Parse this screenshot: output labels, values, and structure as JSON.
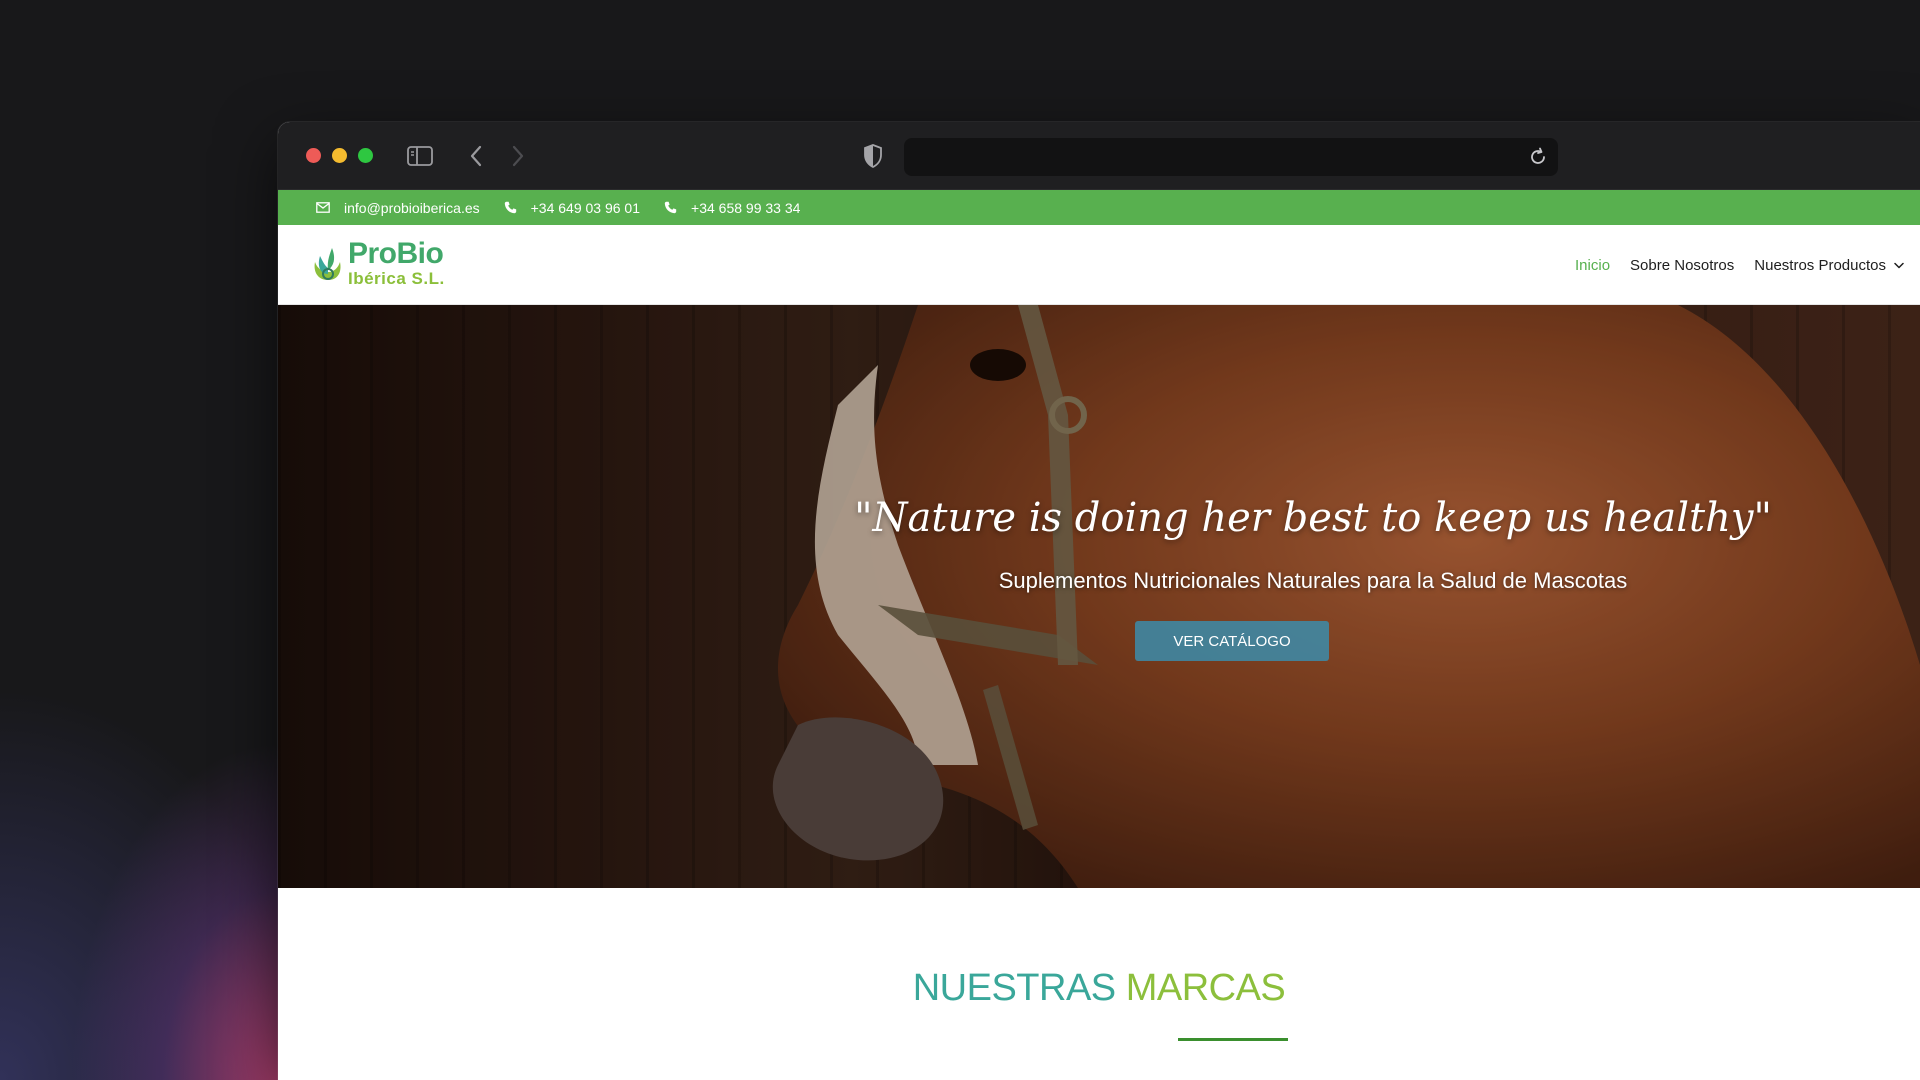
{
  "browser": {
    "address_bar_value": ""
  },
  "topbar": {
    "email": "info@probioiberica.es",
    "phone1": "+34 649 03 96 01",
    "phone2": "+34 658 99 33 34"
  },
  "logo": {
    "line1": "ProBio",
    "line2": "Ibérica S.L."
  },
  "nav": {
    "items": [
      {
        "label": "Inicio",
        "active": true
      },
      {
        "label": "Sobre Nosotros",
        "active": false
      },
      {
        "label": "Nuestros Productos",
        "active": false,
        "has_dropdown": true
      }
    ]
  },
  "hero": {
    "quote": "\"Nature is doing her best to keep us healthy\"",
    "subtitle": "Suplementos Nutricionales Naturales para la Salud de Mascotas",
    "button_label": "VER CATÁLOGO"
  },
  "brands": {
    "title_part1": "NUESTRAS ",
    "title_part2": "MARCAS"
  },
  "colors": {
    "topbar_green": "#58b04f",
    "nav_active": "#58b04f",
    "button": "#3c8caa",
    "brand_teal": "#3aa79a",
    "brand_lime": "#8cbf3c"
  },
  "icons": {
    "sidebar": "sidebar-icon",
    "back": "chevron-left-icon",
    "forward": "chevron-right-icon",
    "shield": "shield-icon",
    "reload": "reload-icon",
    "mail": "mail-icon",
    "phone": "phone-icon",
    "dropdown": "chevron-down-icon",
    "logo": "leaf-logo-icon"
  }
}
